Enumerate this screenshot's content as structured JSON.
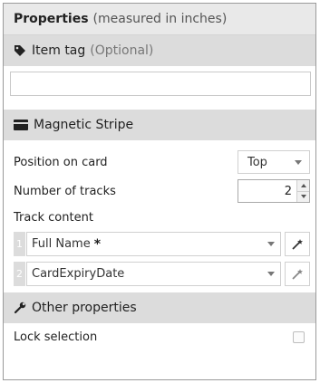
{
  "header": {
    "title": "Properties",
    "subtitle": "(measured in inches)"
  },
  "item_tag": {
    "label": "Item tag",
    "hint": "(Optional)",
    "value": "",
    "icon": "tag-icon"
  },
  "magnetic": {
    "label": "Magnetic Stripe",
    "icon": "card-icon",
    "position": {
      "label": "Position on card",
      "value": "Top"
    },
    "tracks": {
      "label": "Number of tracks",
      "value": "2"
    },
    "content_label": "Track content",
    "track_items": [
      {
        "num": "1",
        "value": "Full Name",
        "required": "*"
      },
      {
        "num": "2",
        "value": "CardExpiryDate"
      }
    ]
  },
  "other": {
    "label": "Other properties",
    "icon": "wrench-icon",
    "lock_label": "Lock selection",
    "lock_checked": false
  },
  "colors": {
    "header_bg": "#e9e9e9",
    "section_bg": "#dcdcdc"
  }
}
